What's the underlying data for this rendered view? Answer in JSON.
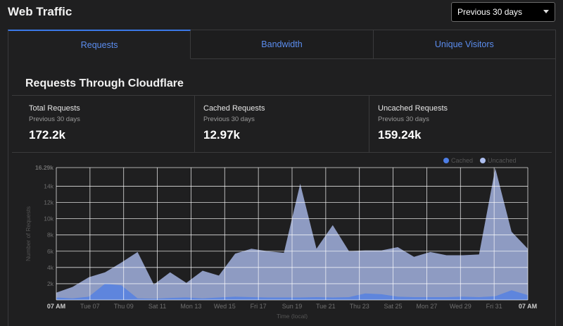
{
  "header": {
    "title": "Web Traffic",
    "range_selected": "Previous 30 days"
  },
  "tabs": [
    {
      "label": "Requests",
      "active": true
    },
    {
      "label": "Bandwidth",
      "active": false
    },
    {
      "label": "Unique Visitors",
      "active": false
    }
  ],
  "panel": {
    "title": "Requests Through Cloudflare"
  },
  "stats": [
    {
      "label": "Total Requests",
      "sub": "Previous 30 days",
      "value": "172.2k"
    },
    {
      "label": "Cached Requests",
      "sub": "Previous 30 days",
      "value": "12.97k"
    },
    {
      "label": "Uncached Requests",
      "sub": "Previous 30 days",
      "value": "159.24k"
    }
  ],
  "colors": {
    "accent": "#3b78e7",
    "uncached": "#aebff0",
    "cached": "#4d7ee6",
    "background": "#1f1f20"
  },
  "chart_data": {
    "type": "area",
    "ylabel": "Number of Requests",
    "xlabel": "Time (local)",
    "ylim": [
      0,
      16290
    ],
    "y_tick_labels": [
      "",
      "2k",
      "4k",
      "6k",
      "8k",
      "10k",
      "12k",
      "14k",
      "16.29k"
    ],
    "y_tick_values": [
      0,
      2000,
      4000,
      6000,
      8000,
      10000,
      12000,
      14000,
      16290
    ],
    "x_tick_labels": [
      "07 AM",
      "Tue 07",
      "Thu 09",
      "Sat 11",
      "Mon 13",
      "Wed 15",
      "Fri 17",
      "Sun 19",
      "Tue 21",
      "Thu 23",
      "Sat 25",
      "Mon 27",
      "Wed 29",
      "Fri 31",
      "07 AM"
    ],
    "legend": {
      "position": "top-right",
      "entries": [
        "Cached",
        "Uncached"
      ]
    },
    "grid": true,
    "series": [
      {
        "name": "Uncached",
        "values": [
          900,
          1600,
          2800,
          3400,
          4600,
          5900,
          1900,
          3400,
          2100,
          3600,
          3000,
          5700,
          6300,
          6000,
          5800,
          14300,
          6300,
          9200,
          6000,
          6100,
          6100,
          6500,
          5300,
          5900,
          5500,
          5500,
          5600,
          16200,
          8400,
          6300
        ]
      },
      {
        "name": "Cached",
        "values": [
          300,
          200,
          400,
          2000,
          1800,
          200,
          150,
          250,
          300,
          200,
          300,
          400,
          350,
          300,
          300,
          300,
          350,
          300,
          350,
          800,
          700,
          400,
          350,
          350,
          350,
          400,
          350,
          450,
          1200,
          600
        ]
      }
    ]
  }
}
